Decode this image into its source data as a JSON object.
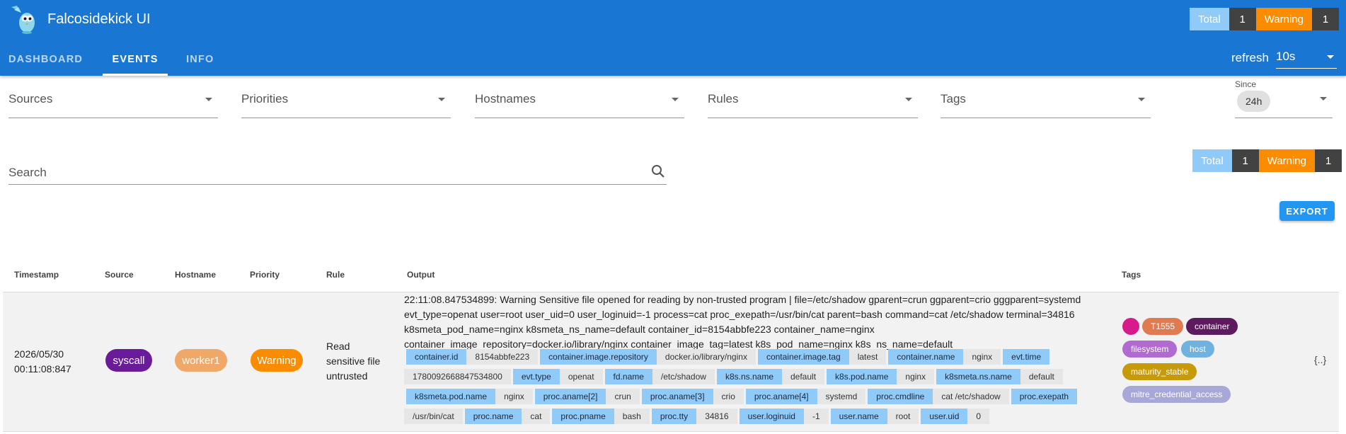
{
  "app": {
    "title": "Falcosidekick UI"
  },
  "header_counts": {
    "total_label": "Total",
    "total": "1",
    "warning_label": "Warning",
    "warning": "1"
  },
  "nav": {
    "tabs": [
      "DASHBOARD",
      "EVENTS",
      "INFO"
    ],
    "active": "EVENTS"
  },
  "refresh": {
    "label": "refresh",
    "value": "10s"
  },
  "filters": {
    "sources": "Sources",
    "priorities": "Priorities",
    "hostnames": "Hostnames",
    "rules": "Rules",
    "tags": "Tags",
    "since_label": "Since",
    "since_value": "24h"
  },
  "search": {
    "placeholder": "Search"
  },
  "counts": {
    "total_label": "Total",
    "total": "1",
    "warning_label": "Warning",
    "warning": "1"
  },
  "export_label": "EXPORT",
  "table": {
    "headers": [
      "Timestamp",
      "Source",
      "Hostname",
      "Priority",
      "Rule",
      "Output",
      "Tags"
    ],
    "row": {
      "timestamp_date": "2026/05/30",
      "timestamp_time": "00:11:08:847",
      "source": "syscall",
      "hostname": "worker1",
      "priority": "Warning",
      "rule_lines": [
        "Read",
        "sensitive file",
        "untrusted"
      ],
      "output_lines": [
        "22:11:08.847534899: Warning Sensitive file opened for reading by non-trusted program | file=/etc/shadow gparent=crun ggparent=crio gggparent=systemd",
        "evt_type=openat user=root user_uid=0 user_loginuid=-1 process=cat proc_exepath=/usr/bin/cat parent=bash command=cat /etc/shadow terminal=34816",
        "k8smeta_pod_name=nginx k8smeta_ns_name=default container_id=8154abbfe223 container_name=nginx",
        "container_image_repository=docker.io/library/nginx container_image_tag=latest k8s_pod_name=nginx k8s_ns_name=default"
      ],
      "fields": [
        [
          [
            "container.id",
            "8154abbfe223"
          ],
          [
            "container.image.repository",
            "docker.io/library/nginx"
          ],
          [
            "container.image.tag",
            "latest"
          ],
          [
            "container.name",
            "nginx"
          ],
          [
            "evt.time",
            ""
          ]
        ],
        [
          [
            "",
            "1780092668847534800"
          ],
          [
            "evt.type",
            "openat"
          ],
          [
            "fd.name",
            "/etc/shadow"
          ],
          [
            "k8s.ns.name",
            "default"
          ],
          [
            "k8s.pod.name",
            "nginx"
          ],
          [
            "k8smeta.ns.name",
            "default"
          ]
        ],
        [
          [
            "k8smeta.pod.name",
            "nginx"
          ],
          [
            "proc.aname[2]",
            "crun"
          ],
          [
            "proc.aname[3]",
            "crio"
          ],
          [
            "proc.aname[4]",
            "systemd"
          ],
          [
            "proc.cmdline",
            "cat /etc/shadow"
          ],
          [
            "proc.exepath",
            ""
          ]
        ],
        [
          [
            "",
            "/usr/bin/cat"
          ],
          [
            "proc.name",
            "cat"
          ],
          [
            "proc.pname",
            "bash"
          ],
          [
            "proc.tty",
            "34816"
          ],
          [
            "user.loginuid",
            "-1"
          ],
          [
            "user.name",
            "root"
          ],
          [
            "user.uid",
            "0"
          ]
        ]
      ],
      "tags": [
        "T1555",
        "container",
        "filesystem",
        "host",
        "maturity_stable",
        "mitre_credential_access"
      ],
      "json_label": "{..}"
    }
  },
  "colors": {
    "appbar": "#1976d2",
    "source_pill": "#6a1b9a",
    "hostname_pill": "#f0a868",
    "warning": "#fb8c00",
    "field_key": "#90caf9",
    "field_value": "#e6e6e6",
    "tag_dot": "#d81b8a",
    "tag_T1555": "#e07a50",
    "tag_container": "#5e1a5e",
    "tag_filesystem": "#b06ad0",
    "tag_host": "#6fb2e0",
    "tag_maturity": "#c79a0a",
    "tag_mitre": "#a8a8d8"
  }
}
